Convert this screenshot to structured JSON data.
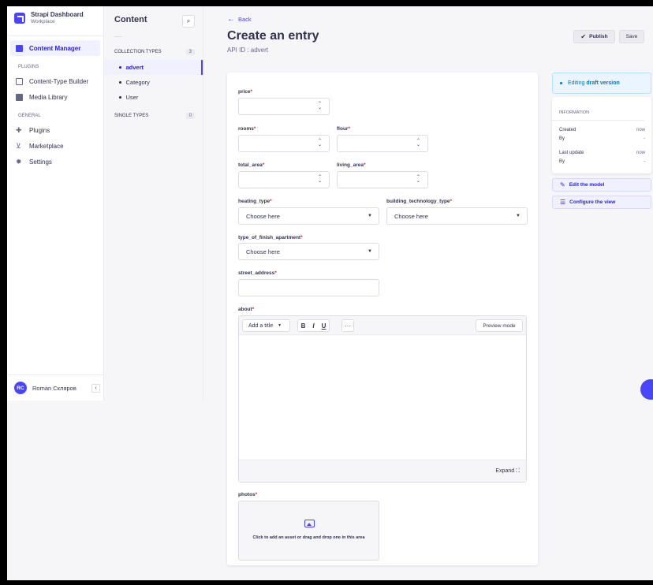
{
  "brand": {
    "title": "Strapi Dashboard",
    "subtitle": "Workplace"
  },
  "mainnav": {
    "active": "Content Manager",
    "plugins_label": "PLUGINS",
    "plugins": [
      "Content-Type Builder",
      "Media Library"
    ],
    "general_label": "GENERAL",
    "general": [
      "Plugins",
      "Marketplace",
      "Settings"
    ]
  },
  "user": {
    "initials": "RC",
    "name": "Roman Скляров",
    "collapse": "‹"
  },
  "subnav": {
    "title": "Content",
    "collection_label": "COLLECTION TYPES",
    "collection_count": "3",
    "collection_items": [
      "advert",
      "Category",
      "User"
    ],
    "single_label": "SINGLE TYPES",
    "single_count": "0"
  },
  "header": {
    "back": "Back",
    "title": "Create an entry",
    "api_id": "API ID : advert",
    "publish": "Publish",
    "save": "Save"
  },
  "form": {
    "price": "price",
    "rooms": "rooms",
    "flour": "flour",
    "total_area": "total_area",
    "living_area": "living_area",
    "heating_type": "heating_type",
    "building_technology_type": "building_technology_type",
    "type_of_finish_apartment": "type_of_finish_apartment",
    "street_address": "street_address",
    "about": "about",
    "photos": "photos",
    "required_mark": "*",
    "select_placeholder": "Choose here"
  },
  "editor": {
    "title_select": "Add a title",
    "bold": "B",
    "italic": "I",
    "underline": "U",
    "more": "···",
    "preview": "Preview mode",
    "expand": "Expand"
  },
  "upload": {
    "text": "Click to add an asset or drag and drop one in this area"
  },
  "panel": {
    "draft_prefix": "Editing ",
    "draft_strong": "draft version",
    "info_title": "INFORMATION",
    "created_label": "Created",
    "created_value": "now",
    "by_label": "By",
    "by_value": "-",
    "updated_label": "Last update",
    "updated_value": "now",
    "by2_label": "By",
    "by2_value": "-",
    "edit_model": "Edit the model",
    "configure_view": "Configure the view"
  },
  "colors": {
    "primary": "#4945ff",
    "required": "#d02b20",
    "info": "#0c75af"
  }
}
